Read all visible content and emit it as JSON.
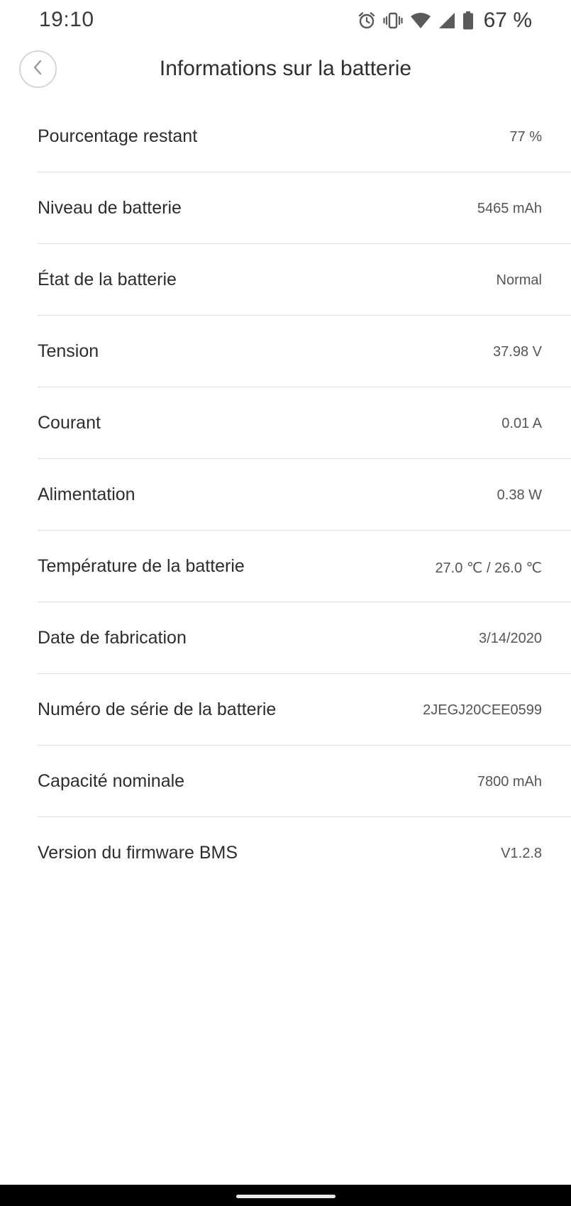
{
  "status_bar": {
    "time": "19:10",
    "battery_percent": "67 %",
    "icons": [
      "alarm-icon",
      "vibrate-icon",
      "wifi-icon",
      "cellular-signal-icon",
      "battery-icon"
    ]
  },
  "header": {
    "title": "Informations sur la batterie",
    "back_icon": "chevron-left-icon"
  },
  "battery_info": {
    "rows": [
      {
        "label": "Pourcentage restant",
        "value": "77 %"
      },
      {
        "label": "Niveau de batterie",
        "value": "5465 mAh"
      },
      {
        "label": "État de la batterie",
        "value": "Normal"
      },
      {
        "label": "Tension",
        "value": "37.98 V"
      },
      {
        "label": "Courant",
        "value": "0.01 A"
      },
      {
        "label": "Alimentation",
        "value": "0.38 W"
      },
      {
        "label": "Température de la batterie",
        "value": "27.0 ℃ / 26.0 ℃"
      },
      {
        "label": "Date de fabrication",
        "value": "3/14/2020"
      },
      {
        "label": "Numéro de série de la batterie",
        "value": "2JEGJ20CEE0599"
      },
      {
        "label": "Capacité nominale",
        "value": "7800 mAh"
      },
      {
        "label": "Version du firmware BMS",
        "value": "V1.2.8"
      }
    ]
  },
  "colors": {
    "background": "#ffffff",
    "text_primary": "#2d2d2d",
    "text_secondary": "#555555",
    "divider": "#dddddd",
    "nav_bar": "#000000"
  }
}
